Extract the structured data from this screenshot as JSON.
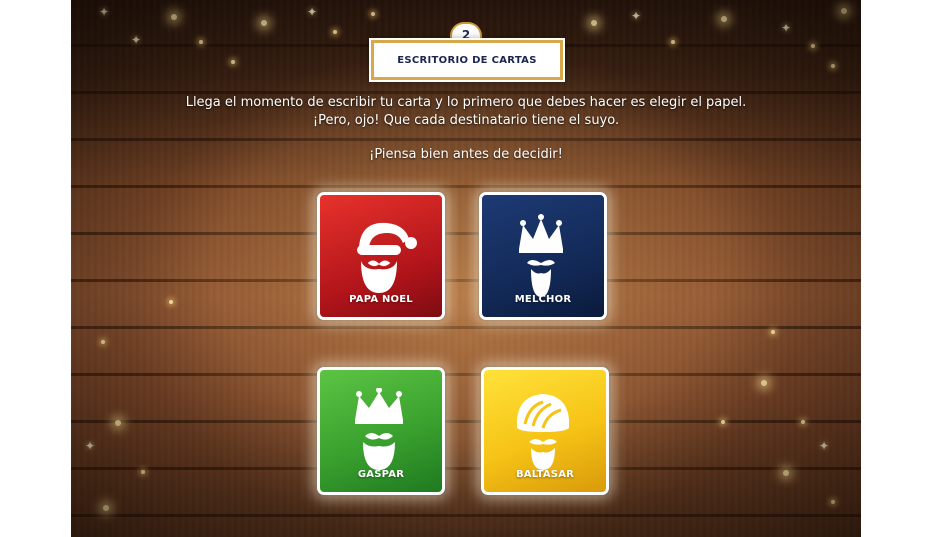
{
  "header": {
    "step_number": "2",
    "title": "ESCRITORIO DE CARTAS"
  },
  "intro": {
    "line1": "Llega el momento de escribir tu carta y lo primero que debes hacer es elegir el papel.",
    "line2": "¡Pero, ojo! Que cada destinatario tiene el suyo.",
    "line3": "¡Piensa bien antes de decidir!"
  },
  "cards": [
    {
      "label": "PAPA NOEL",
      "icon": "santa-claus-icon",
      "color": "#c41a1f"
    },
    {
      "label": "MELCHOR",
      "icon": "king-melchor-icon",
      "color": "#132a58"
    },
    {
      "label": "GASPAR",
      "icon": "king-gaspar-icon",
      "color": "#3aa12e"
    },
    {
      "label": "BALTASAR",
      "icon": "king-baltasar-icon",
      "color": "#f6c316"
    }
  ],
  "colors": {
    "frame_gold": "#d7a94a",
    "title_text": "#1c2450",
    "wood": "#8e5430"
  }
}
